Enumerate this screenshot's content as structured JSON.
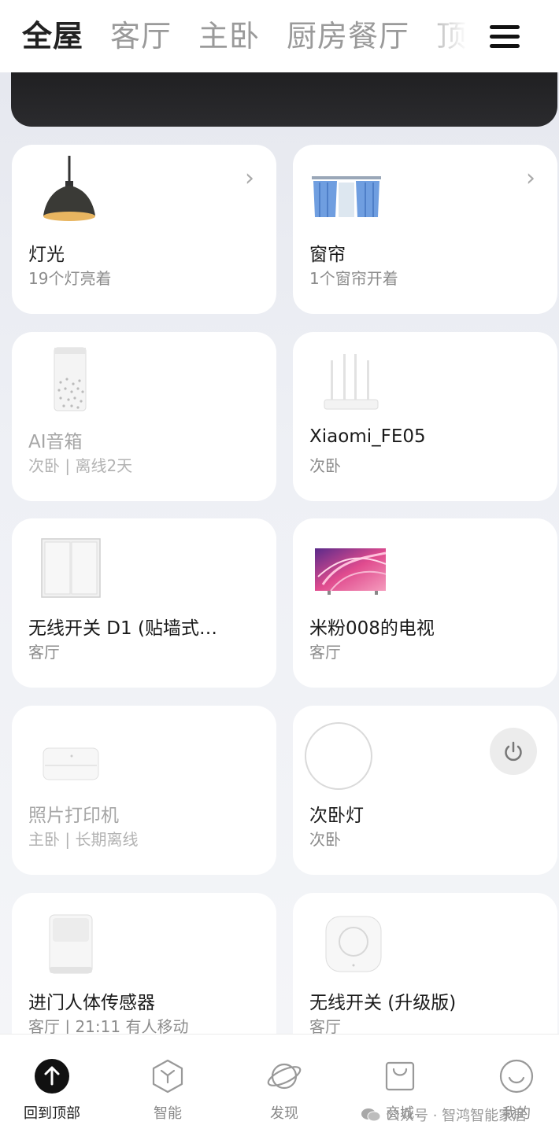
{
  "tabs": [
    "全屋",
    "客厅",
    "主卧",
    "厨房餐厅",
    "顶"
  ],
  "cards": [
    {
      "name": "灯光",
      "sub": "19个灯亮着",
      "icon": "pendant-lamp-icon"
    },
    {
      "name": "窗帘",
      "sub": "1个窗帘开着",
      "icon": "curtain-icon"
    },
    {
      "name": "AI音箱",
      "sub": "次卧 | 离线2天",
      "icon": "ai-speaker-icon"
    },
    {
      "name": "Xiaomi_FE05",
      "sub": "次卧",
      "icon": "router-icon"
    },
    {
      "name": "无线开关 D1 (贴墙式…",
      "sub": "客厅",
      "icon": "wall-switch-icon"
    },
    {
      "name": "米粉008的电视",
      "sub": "客厅",
      "icon": "tv-icon"
    },
    {
      "name": "照片打印机",
      "sub": "主卧 | 长期离线",
      "icon": "photo-printer-icon"
    },
    {
      "name": "次卧灯",
      "sub": "次卧",
      "icon": "ceiling-light-icon"
    },
    {
      "name": "进门人体传感器",
      "sub": "客厅 | 21:11 有人移动",
      "icon": "motion-sensor-icon"
    },
    {
      "name": "无线开关 (升级版)",
      "sub": "客厅",
      "icon": "wireless-button-icon"
    }
  ],
  "bottom_nav": [
    {
      "label": "回到顶部",
      "icon": "arrow-up-icon"
    },
    {
      "label": "智能",
      "icon": "smart-icon"
    },
    {
      "label": "发现",
      "icon": "planet-icon"
    },
    {
      "label": "商城",
      "icon": "shopping-bag-icon"
    },
    {
      "label": "我的",
      "icon": "smiley-icon"
    }
  ],
  "watermark": "公众号 · 智鸿智能家居"
}
